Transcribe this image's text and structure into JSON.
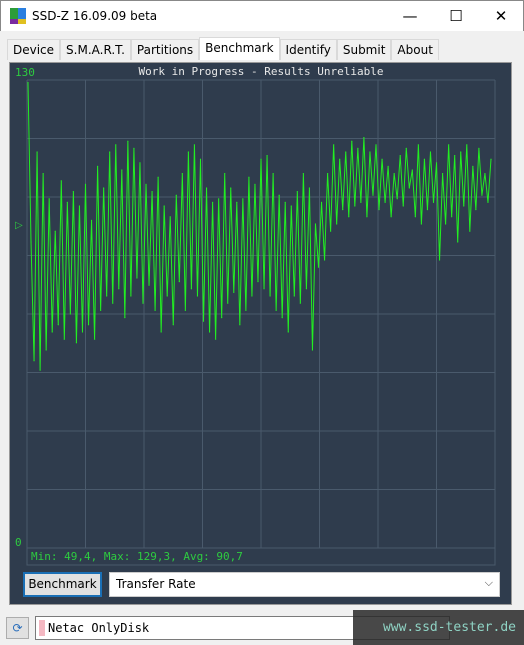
{
  "window": {
    "title": "SSD-Z 16.09.09 beta",
    "minimize": "—",
    "maximize": "☐",
    "close": "✕"
  },
  "tabs": [
    {
      "label": "Device"
    },
    {
      "label": "S.M.A.R.T."
    },
    {
      "label": "Partitions"
    },
    {
      "label": "Benchmark",
      "active": true
    },
    {
      "label": "Identify"
    },
    {
      "label": "Submit"
    },
    {
      "label": "About"
    }
  ],
  "chart_data": {
    "type": "line",
    "title": "Work in Progress - Results Unreliable",
    "ylim": [
      0,
      130
    ],
    "y_tick_labels": [
      "130",
      "0"
    ],
    "avg_marker": "▷",
    "grid": true,
    "line_color": "#22ee22",
    "stats": "Min: 49,4, Max: 129,3, Avg: 90,7",
    "values": [
      129.3,
      85,
      52,
      110,
      49.4,
      104,
      55,
      97,
      60,
      88,
      62,
      102,
      58,
      96,
      65,
      99,
      57,
      95,
      60,
      101,
      62,
      91,
      58,
      106,
      66,
      100,
      70,
      110,
      68,
      112,
      72,
      105,
      64,
      113,
      70,
      111,
      75,
      107,
      68,
      101,
      73,
      99,
      66,
      103,
      60,
      95,
      70,
      92,
      62,
      98,
      74,
      104,
      66,
      110,
      72,
      112,
      70,
      108,
      63,
      100,
      60,
      96,
      58,
      97,
      64,
      104,
      68,
      100,
      71,
      96,
      62,
      97,
      66,
      103,
      70,
      101,
      74,
      108,
      72,
      109,
      70,
      104,
      66,
      98,
      64,
      96,
      60,
      95,
      70,
      99,
      68,
      104,
      72,
      100,
      55,
      90,
      78,
      96,
      80,
      104,
      88,
      112,
      90,
      108,
      94,
      110,
      92,
      113,
      95,
      111,
      96,
      114,
      92,
      110,
      98,
      112,
      94,
      108,
      96,
      106,
      92,
      104,
      97,
      109,
      95,
      111,
      100,
      105,
      92,
      112,
      90,
      108,
      94,
      110,
      96,
      107,
      80,
      104,
      90,
      112,
      92,
      109,
      85,
      110,
      95,
      112,
      88,
      106,
      94,
      111,
      98,
      104,
      96,
      108
    ]
  },
  "controls": {
    "benchmark_button": "Benchmark",
    "mode_select": "Transfer Rate"
  },
  "footer": {
    "drive": "Netac OnlyDisk",
    "watermark": "www.ssd-tester.de"
  }
}
